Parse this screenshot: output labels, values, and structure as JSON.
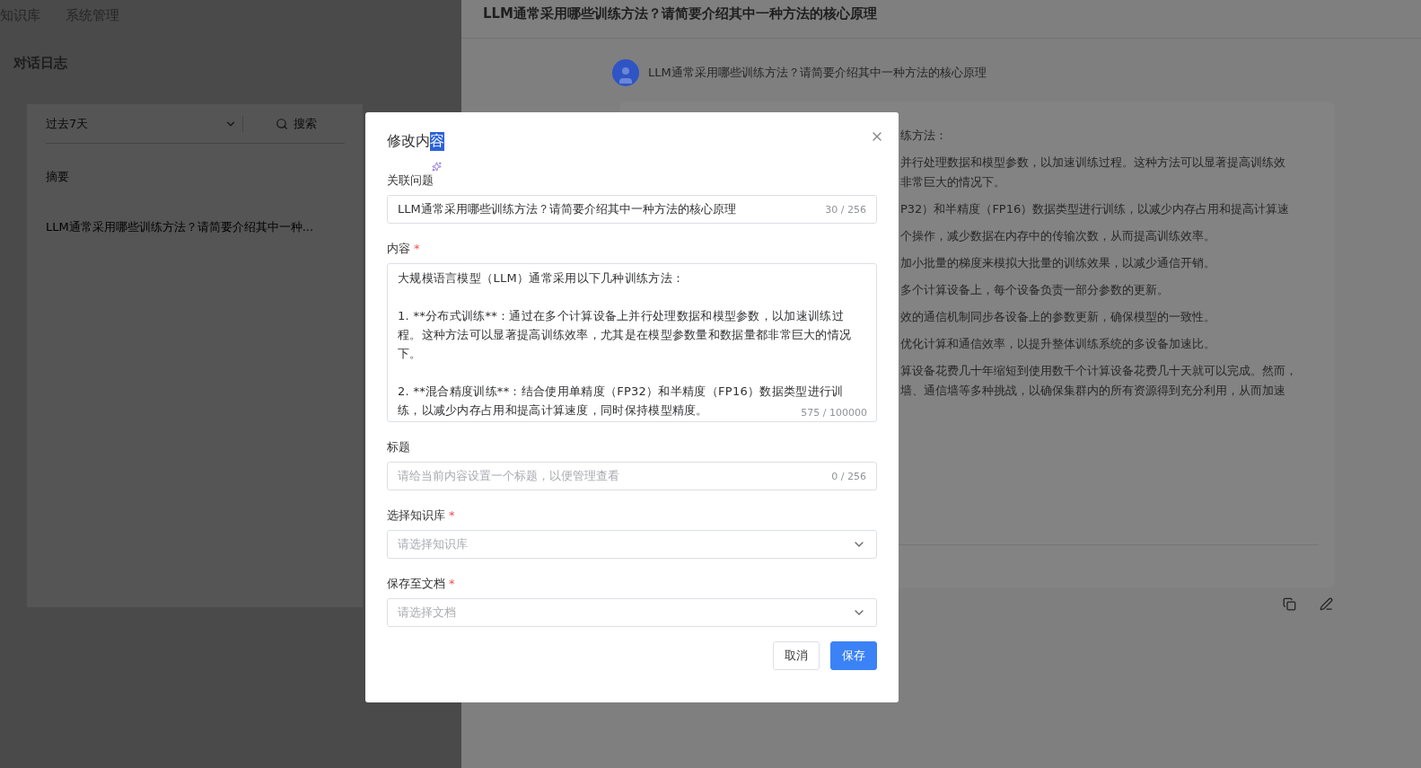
{
  "nav": {
    "items": [
      {
        "label": "知识库"
      },
      {
        "label": "系统管理"
      }
    ]
  },
  "sidebar": {
    "title": "对话日志",
    "filter": {
      "value": "过去7天"
    },
    "search": {
      "placeholder": "搜索"
    },
    "column": "摘要",
    "rows": [
      "LLM通常采用哪些训练方法？请简要介绍其中一种..."
    ]
  },
  "conversation": {
    "title": "LLM通常采用哪些训练方法？请简要介绍其中一种方法的核心原理",
    "question": "LLM通常采用哪些训练方法？请简要介绍其中一种方法的核心原理",
    "answer_paragraphs": [
      {
        "lines": [
          "练方法："
        ]
      },
      {
        "lines": [
          "并行处理数据和模型参数，以加速训练过程。这种方法可以显著提高训练效",
          "非常巨大的情况下。"
        ]
      },
      {
        "lines": [
          "P32）和半精度（FP16）数据类型进行训练，以减少内存占用和提高计算速"
        ]
      },
      {
        "lines": [
          "个操作，减少数据在内存中的传输次数，从而提高训练效率。"
        ]
      },
      {
        "lines": [
          "加小批量的梯度来模拟大批量的训练效果，以减少通信开销。"
        ]
      },
      {
        "lines": [
          "多个计算设备上，每个设备负责一部分参数的更新。"
        ]
      },
      {
        "lines": [
          "效的通信机制同步各设备上的参数更新，确保模型的一致性。"
        ]
      },
      {
        "lines": [
          "优化计算和通信效率，以提升整体训练系统的多设备加速比。"
        ]
      },
      {
        "lines": [
          "算设备花费几十年缩短到使用数千个计算设备花费几十天就可以完成。然而，",
          "墙、通信墙等多种挑战，以确保集群内的所有资源得到充分利用，从而加速"
        ]
      }
    ]
  },
  "dialog": {
    "title": "修改内",
    "title_selected": "容",
    "fields": [
      {
        "kind": "input",
        "label": "关联问题",
        "value": "LLM通常采用哪些训练方法？请简要介绍其中一种方法的核心原理",
        "count": "30 / 256"
      },
      {
        "kind": "textarea",
        "label": "内容",
        "required_mark": "*",
        "value": "大规模语言模型（LLM）通常采用以下几种训练方法：\n\n1. **分布式训练**：通过在多个计算设备上并行处理数据和模型参数，以加速训练过程。这种方法可以显著提高训练效率，尤其是在模型参数量和数据量都非常巨大的情况下。\n\n2. **混合精度训练**：结合使用单精度（FP32）和半精度（FP16）数据类型进行训练，以减少内存占用和提高计算速度，同时保持模型精度。",
        "count": "575 / 100000"
      },
      {
        "kind": "input",
        "label": "标题",
        "placeholder": "请给当前内容设置一个标题，以便管理查看",
        "count": "0 / 256"
      },
      {
        "kind": "select",
        "label": "选择知识库",
        "required_mark": "*",
        "placeholder": "请选择知识库"
      },
      {
        "kind": "select",
        "label": "保存至文档",
        "required_mark": "*",
        "placeholder": "请选择文档"
      }
    ],
    "buttons": [
      {
        "label": "取消",
        "primary": false
      },
      {
        "label": "保存",
        "primary": true
      }
    ]
  }
}
